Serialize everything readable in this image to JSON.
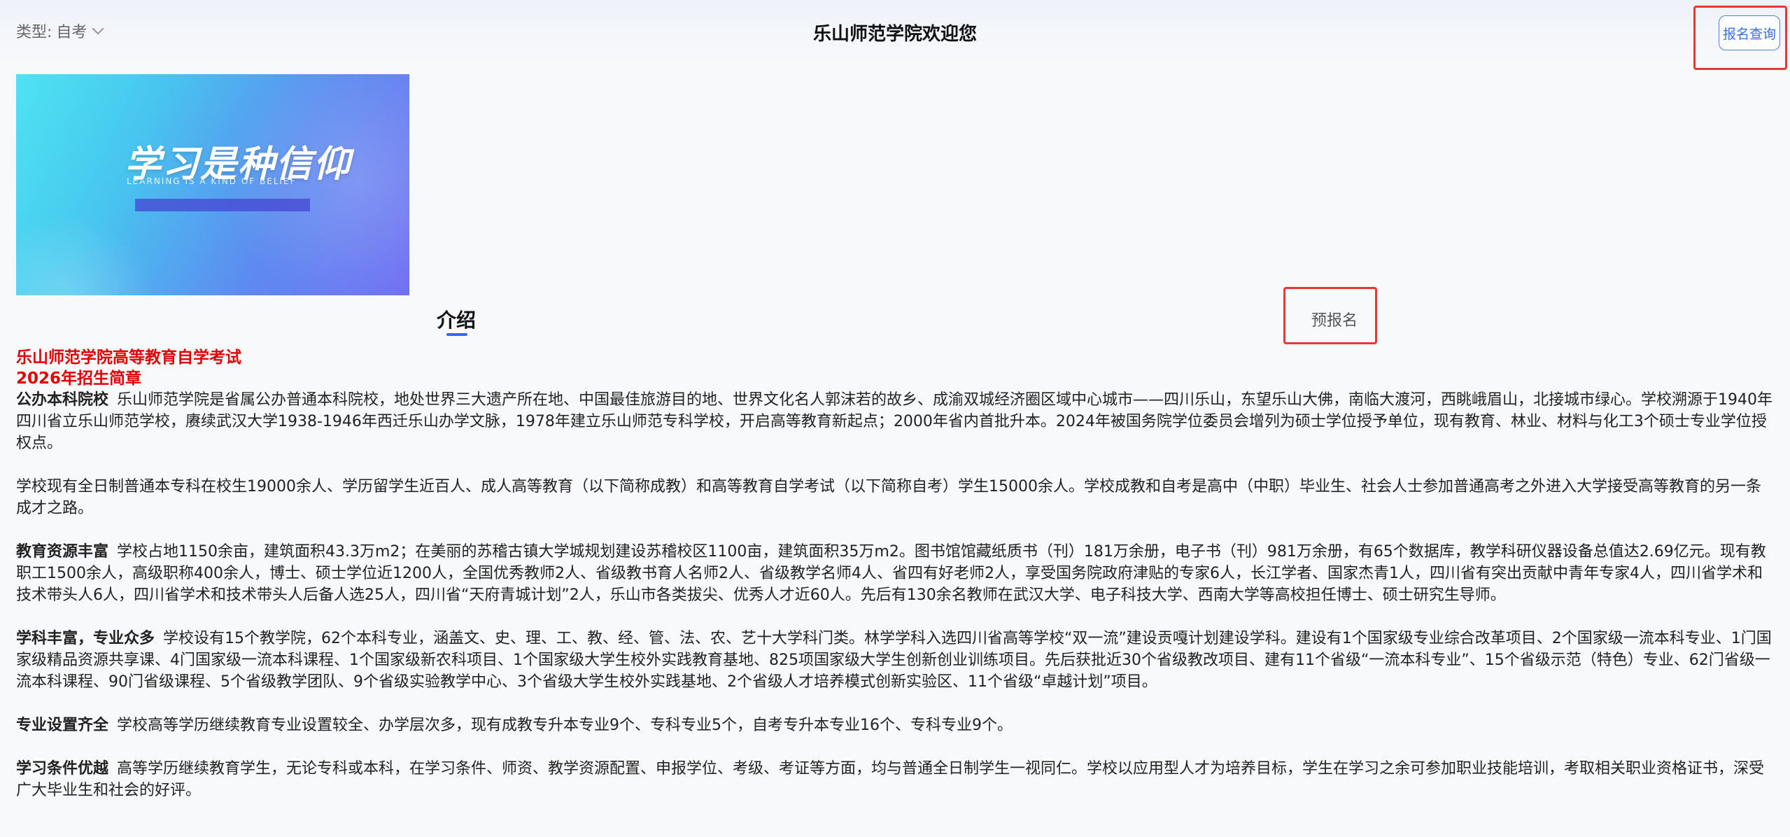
{
  "header": {
    "type_label": "类型:",
    "type_value": "自考",
    "title": "乐山师范学院欢迎您",
    "query_button": "报名查询"
  },
  "banner": {
    "slogan": "学习是种信仰",
    "slogan_en": "LEARNING IS A KIND OF BELIEF"
  },
  "tabs": {
    "intro": "介绍",
    "pre_register": "预报名"
  },
  "content": {
    "title_line1": "乐山师范学院高等教育自学考试",
    "title_line2": "2026年招生简章",
    "sections": [
      {
        "heading": "公办本科院校",
        "text": "乐山师范学院是省属公办普通本科院校，地处世界三大遗产所在地、中国最佳旅游目的地、世界文化名人郭沫若的故乡、成渝双城经济圈区域中心城市——四川乐山，东望乐山大佛，南临大渡河，西眺峨眉山，北接城市绿心。学校溯源于1940年四川省立乐山师范学校，赓续武汉大学1938-1946年西迁乐山办学文脉，1978年建立乐山师范专科学校，开启高等教育新起点；2000年省内首批升本。2024年被国务院学位委员会增列为硕士学位授予单位，现有教育、林业、材料与化工3个硕士专业学位授权点。"
      },
      {
        "heading": "",
        "text": "学校现有全日制普通本专科在校生19000余人、学历留学生近百人、成人高等教育（以下简称成教）和高等教育自学考试（以下简称自考）学生15000余人。学校成教和自考是高中（中职）毕业生、社会人士参加普通高考之外进入大学接受高等教育的另一条成才之路。"
      },
      {
        "heading": "教育资源丰富",
        "text": "学校占地1150余亩，建筑面积43.3万m2；在美丽的苏稽古镇大学城规划建设苏稽校区1100亩，建筑面积35万m2。图书馆馆藏纸质书（刊）181万余册，电子书（刊）981万余册，有65个数据库，教学科研仪器设备总值达2.69亿元。现有教职工1500余人，高级职称400余人，博士、硕士学位近1200人，全国优秀教师2人、省级教书育人名师2人、省级教学名师4人、省四有好老师2人，享受国务院政府津贴的专家6人，长江学者、国家杰青1人，四川省有突出贡献中青年专家4人，四川省学术和技术带头人6人，四川省学术和技术带头人后备人选25人，四川省“天府青城计划”2人，乐山市各类拔尖、优秀人才近60人。先后有130余名教师在武汉大学、电子科技大学、西南大学等高校担任博士、硕士研究生导师。"
      },
      {
        "heading": "学科丰富，专业众多",
        "text": "学校设有15个教学院，62个本科专业，涵盖文、史、理、工、教、经、管、法、农、艺十大学科门类。林学学科入选四川省高等学校“双一流”建设贡嘎计划建设学科。建设有1个国家级专业综合改革项目、2个国家级一流本科专业、1门国家级精品资源共享课、4门国家级一流本科课程、1个国家级新农科项目、1个国家级大学生校外实践教育基地、825项国家级大学生创新创业训练项目。先后获批近30个省级教改项目、建有11个省级“一流本科专业”、15个省级示范（特色）专业、62门省级一流本科课程、90门省级课程、5个省级教学团队、9个省级实验教学中心、3个省级大学生校外实践基地、2个省级人才培养模式创新实验区、11个省级“卓越计划”项目。"
      },
      {
        "heading": "专业设置齐全",
        "text": "学校高等学历继续教育专业设置较全、办学层次多，现有成教专升本专业9个、专科专业5个，自考专升本专业16个、专科专业9个。"
      },
      {
        "heading": "学习条件优越",
        "text": "高等学历继续教育学生，无论专科或本科，在学习条件、师资、教学资源配置、申报学位、考级、考证等方面，均与普通全日制学生一视同仁。学校以应用型人才为培养目标，学生在学习之余可参加职业技能培训，考取相关职业资格证书，深受广大毕业生和社会的好评。"
      }
    ]
  }
}
